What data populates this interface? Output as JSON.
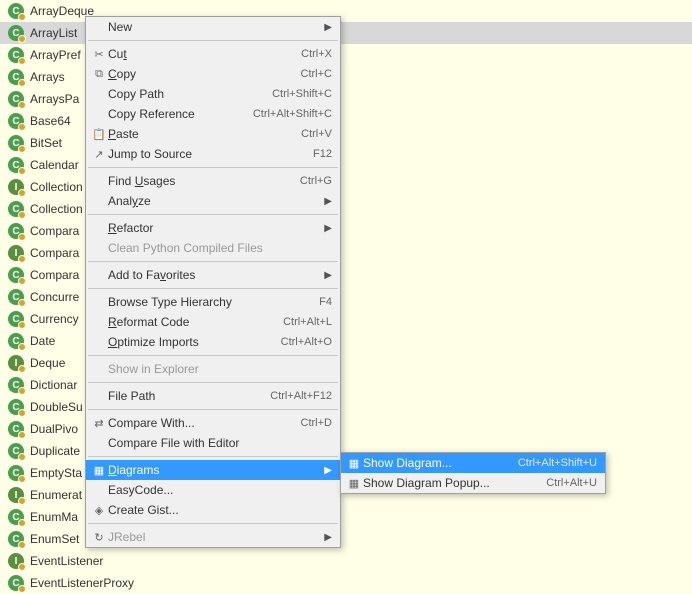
{
  "class_list": [
    {
      "name": "ArrayDeque",
      "icon": "C"
    },
    {
      "name": "ArrayList",
      "icon": "C",
      "selected": true
    },
    {
      "name": "ArrayPref",
      "icon": "C"
    },
    {
      "name": "Arrays",
      "icon": "C"
    },
    {
      "name": "ArraysPa",
      "icon": "C"
    },
    {
      "name": "Base64",
      "icon": "C"
    },
    {
      "name": "BitSet",
      "icon": "C"
    },
    {
      "name": "Calendar",
      "icon": "C"
    },
    {
      "name": "Collection",
      "icon": "I"
    },
    {
      "name": "Collection",
      "icon": "C"
    },
    {
      "name": "Compara",
      "icon": "C"
    },
    {
      "name": "Compara",
      "icon": "I"
    },
    {
      "name": "Compara",
      "icon": "C"
    },
    {
      "name": "Concurre",
      "icon": "C"
    },
    {
      "name": "Currency",
      "icon": "C"
    },
    {
      "name": "Date",
      "icon": "C"
    },
    {
      "name": "Deque",
      "icon": "I"
    },
    {
      "name": "Dictionar",
      "icon": "C"
    },
    {
      "name": "DoubleSu",
      "icon": "C"
    },
    {
      "name": "DualPivo",
      "icon": "C"
    },
    {
      "name": "Duplicate",
      "icon": "C"
    },
    {
      "name": "EmptySta",
      "icon": "C"
    },
    {
      "name": "Enumerat",
      "icon": "I"
    },
    {
      "name": "EnumMa",
      "icon": "C"
    },
    {
      "name": "EnumSet",
      "icon": "C"
    },
    {
      "name": "EventListener",
      "icon": "I"
    },
    {
      "name": "EventListenerProxy",
      "icon": "C"
    }
  ],
  "menu": [
    {
      "label": "New",
      "submenu": true
    },
    {
      "sep": true
    },
    {
      "label": "Cut",
      "underline": 2,
      "shortcut": "Ctrl+X",
      "icon": "scissors"
    },
    {
      "label": "Copy",
      "underline": 0,
      "shortcut": "Ctrl+C",
      "icon": "copy"
    },
    {
      "label": "Copy Path",
      "shortcut": "Ctrl+Shift+C"
    },
    {
      "label": "Copy Reference",
      "shortcut": "Ctrl+Alt+Shift+C"
    },
    {
      "label": "Paste",
      "underline": 0,
      "shortcut": "Ctrl+V",
      "icon": "paste"
    },
    {
      "label": "Jump to Source",
      "shortcut": "F12",
      "icon": "jump"
    },
    {
      "sep": true
    },
    {
      "label": "Find Usages",
      "underline": 5,
      "shortcut": "Ctrl+G"
    },
    {
      "label": "Analyze",
      "underline": 4,
      "submenu": true
    },
    {
      "sep": true
    },
    {
      "label": "Refactor",
      "underline": 0,
      "submenu": true
    },
    {
      "label": "Clean Python Compiled Files",
      "disabled": true
    },
    {
      "sep": true
    },
    {
      "label": "Add to Favorites",
      "underline": 9,
      "submenu": true
    },
    {
      "sep": true
    },
    {
      "label": "Browse Type Hierarchy",
      "shortcut": "F4"
    },
    {
      "label": "Reformat Code",
      "underline": 0,
      "shortcut": "Ctrl+Alt+L"
    },
    {
      "label": "Optimize Imports",
      "underline": 0,
      "shortcut": "Ctrl+Alt+O"
    },
    {
      "sep": true
    },
    {
      "label": "Show in Explorer",
      "disabled": true
    },
    {
      "sep": true
    },
    {
      "label": "File Path",
      "underline": 9,
      "shortcut": "Ctrl+Alt+F12"
    },
    {
      "sep": true
    },
    {
      "label": "Compare With...",
      "shortcut": "Ctrl+D",
      "icon": "compare"
    },
    {
      "label": "Compare File with Editor"
    },
    {
      "sep": true
    },
    {
      "label": "Diagrams",
      "underline": 0,
      "submenu": true,
      "highlighted": true,
      "icon": "diagram"
    },
    {
      "label": "EasyCode..."
    },
    {
      "label": "Create Gist...",
      "icon": "gist"
    },
    {
      "sep": true
    },
    {
      "label": "JRebel",
      "disabled": true,
      "submenu": true,
      "icon": "jrebel"
    }
  ],
  "submenu_items": [
    {
      "label": "Show Diagram...",
      "shortcut": "Ctrl+Alt+Shift+U",
      "highlighted": true,
      "icon": "showdiag"
    },
    {
      "label": "Show Diagram Popup...",
      "shortcut": "Ctrl+Alt+U",
      "icon": "showdiag"
    }
  ]
}
